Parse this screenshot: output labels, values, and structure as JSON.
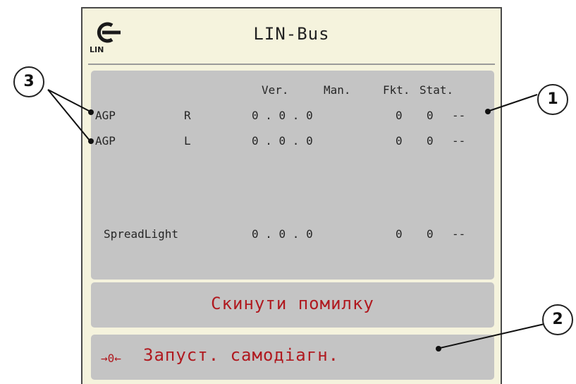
{
  "header": {
    "title": "LIN-Bus",
    "icon_label": "LIN"
  },
  "columns": {
    "ver": "Ver.",
    "man": "Man.",
    "fkt": "Fkt.",
    "stat": "Stat."
  },
  "rows": [
    {
      "name": "AGP",
      "side": "R",
      "ver": "0 . 0 . 0",
      "man": "",
      "fkt": "0",
      "stat_code": "0",
      "stat": "--"
    },
    {
      "name": "AGP",
      "side": "L",
      "ver": "0 . 0 . 0",
      "man": "",
      "fkt": "0",
      "stat_code": "0",
      "stat": "--"
    },
    {
      "name": "SpreadLight",
      "side": "",
      "ver": "0 . 0 . 0",
      "man": "",
      "fkt": "0",
      "stat_code": "0",
      "stat": "--"
    }
  ],
  "buttons": {
    "reset_error": "Скинути помилку",
    "self_diagnosis": "Запуст. самодіагн.",
    "self_diagnosis_icon": "→0←"
  },
  "callouts": {
    "c1": "1",
    "c2": "2",
    "c3": "3"
  },
  "colors": {
    "screen_bg": "#f5f3dd",
    "panel_bg": "#c4c4c4",
    "accent_red": "#b0191f"
  }
}
